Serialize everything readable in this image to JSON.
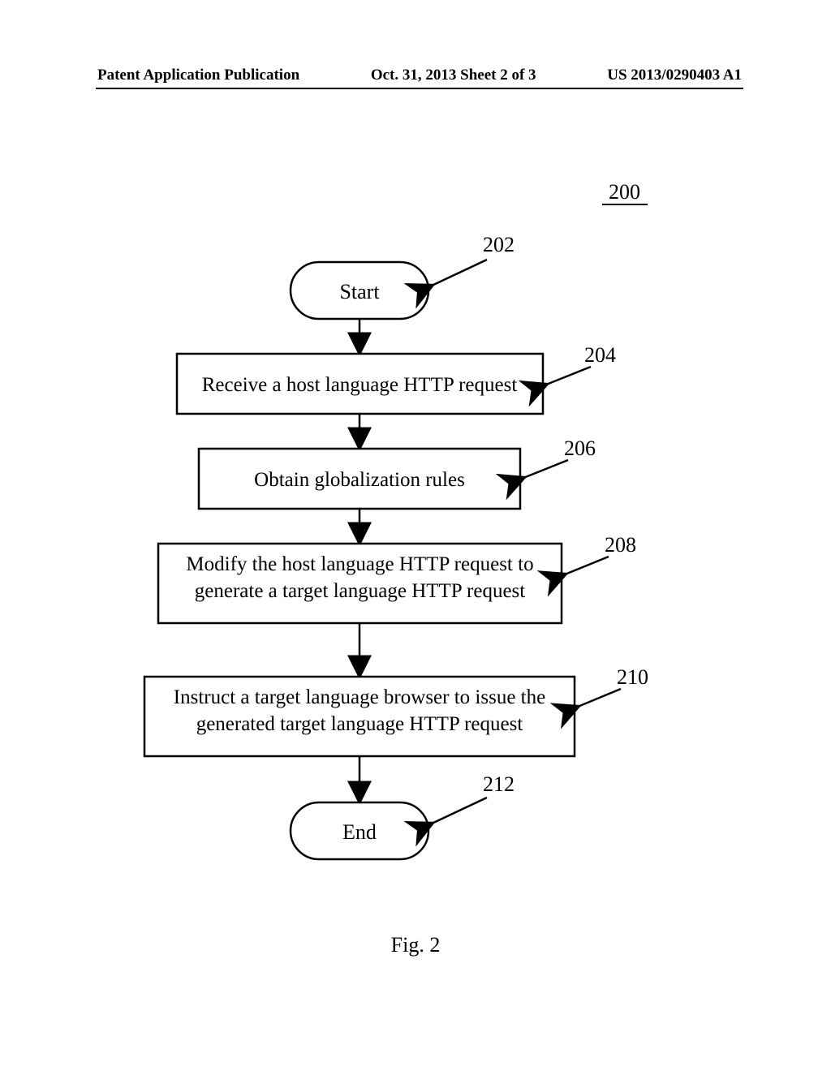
{
  "header": {
    "left": "Patent Application Publication",
    "center": "Oct. 31, 2013  Sheet 2 of 3",
    "right": "US 2013/0290403 A1"
  },
  "diagram": {
    "figure_ref": "200",
    "start_label": "Start",
    "end_label": "End",
    "steps": [
      {
        "ref": "202",
        "text": ""
      },
      {
        "ref": "204",
        "text": "Receive a host language HTTP request"
      },
      {
        "ref": "206",
        "text": "Obtain globalization rules"
      },
      {
        "ref": "208",
        "text": "Modify the host language HTTP request to generate a target language HTTP request"
      },
      {
        "ref": "210",
        "text": "Instruct a target language browser to issue the generated target language HTTP request"
      },
      {
        "ref": "212",
        "text": ""
      }
    ]
  },
  "caption": "Fig. 2"
}
